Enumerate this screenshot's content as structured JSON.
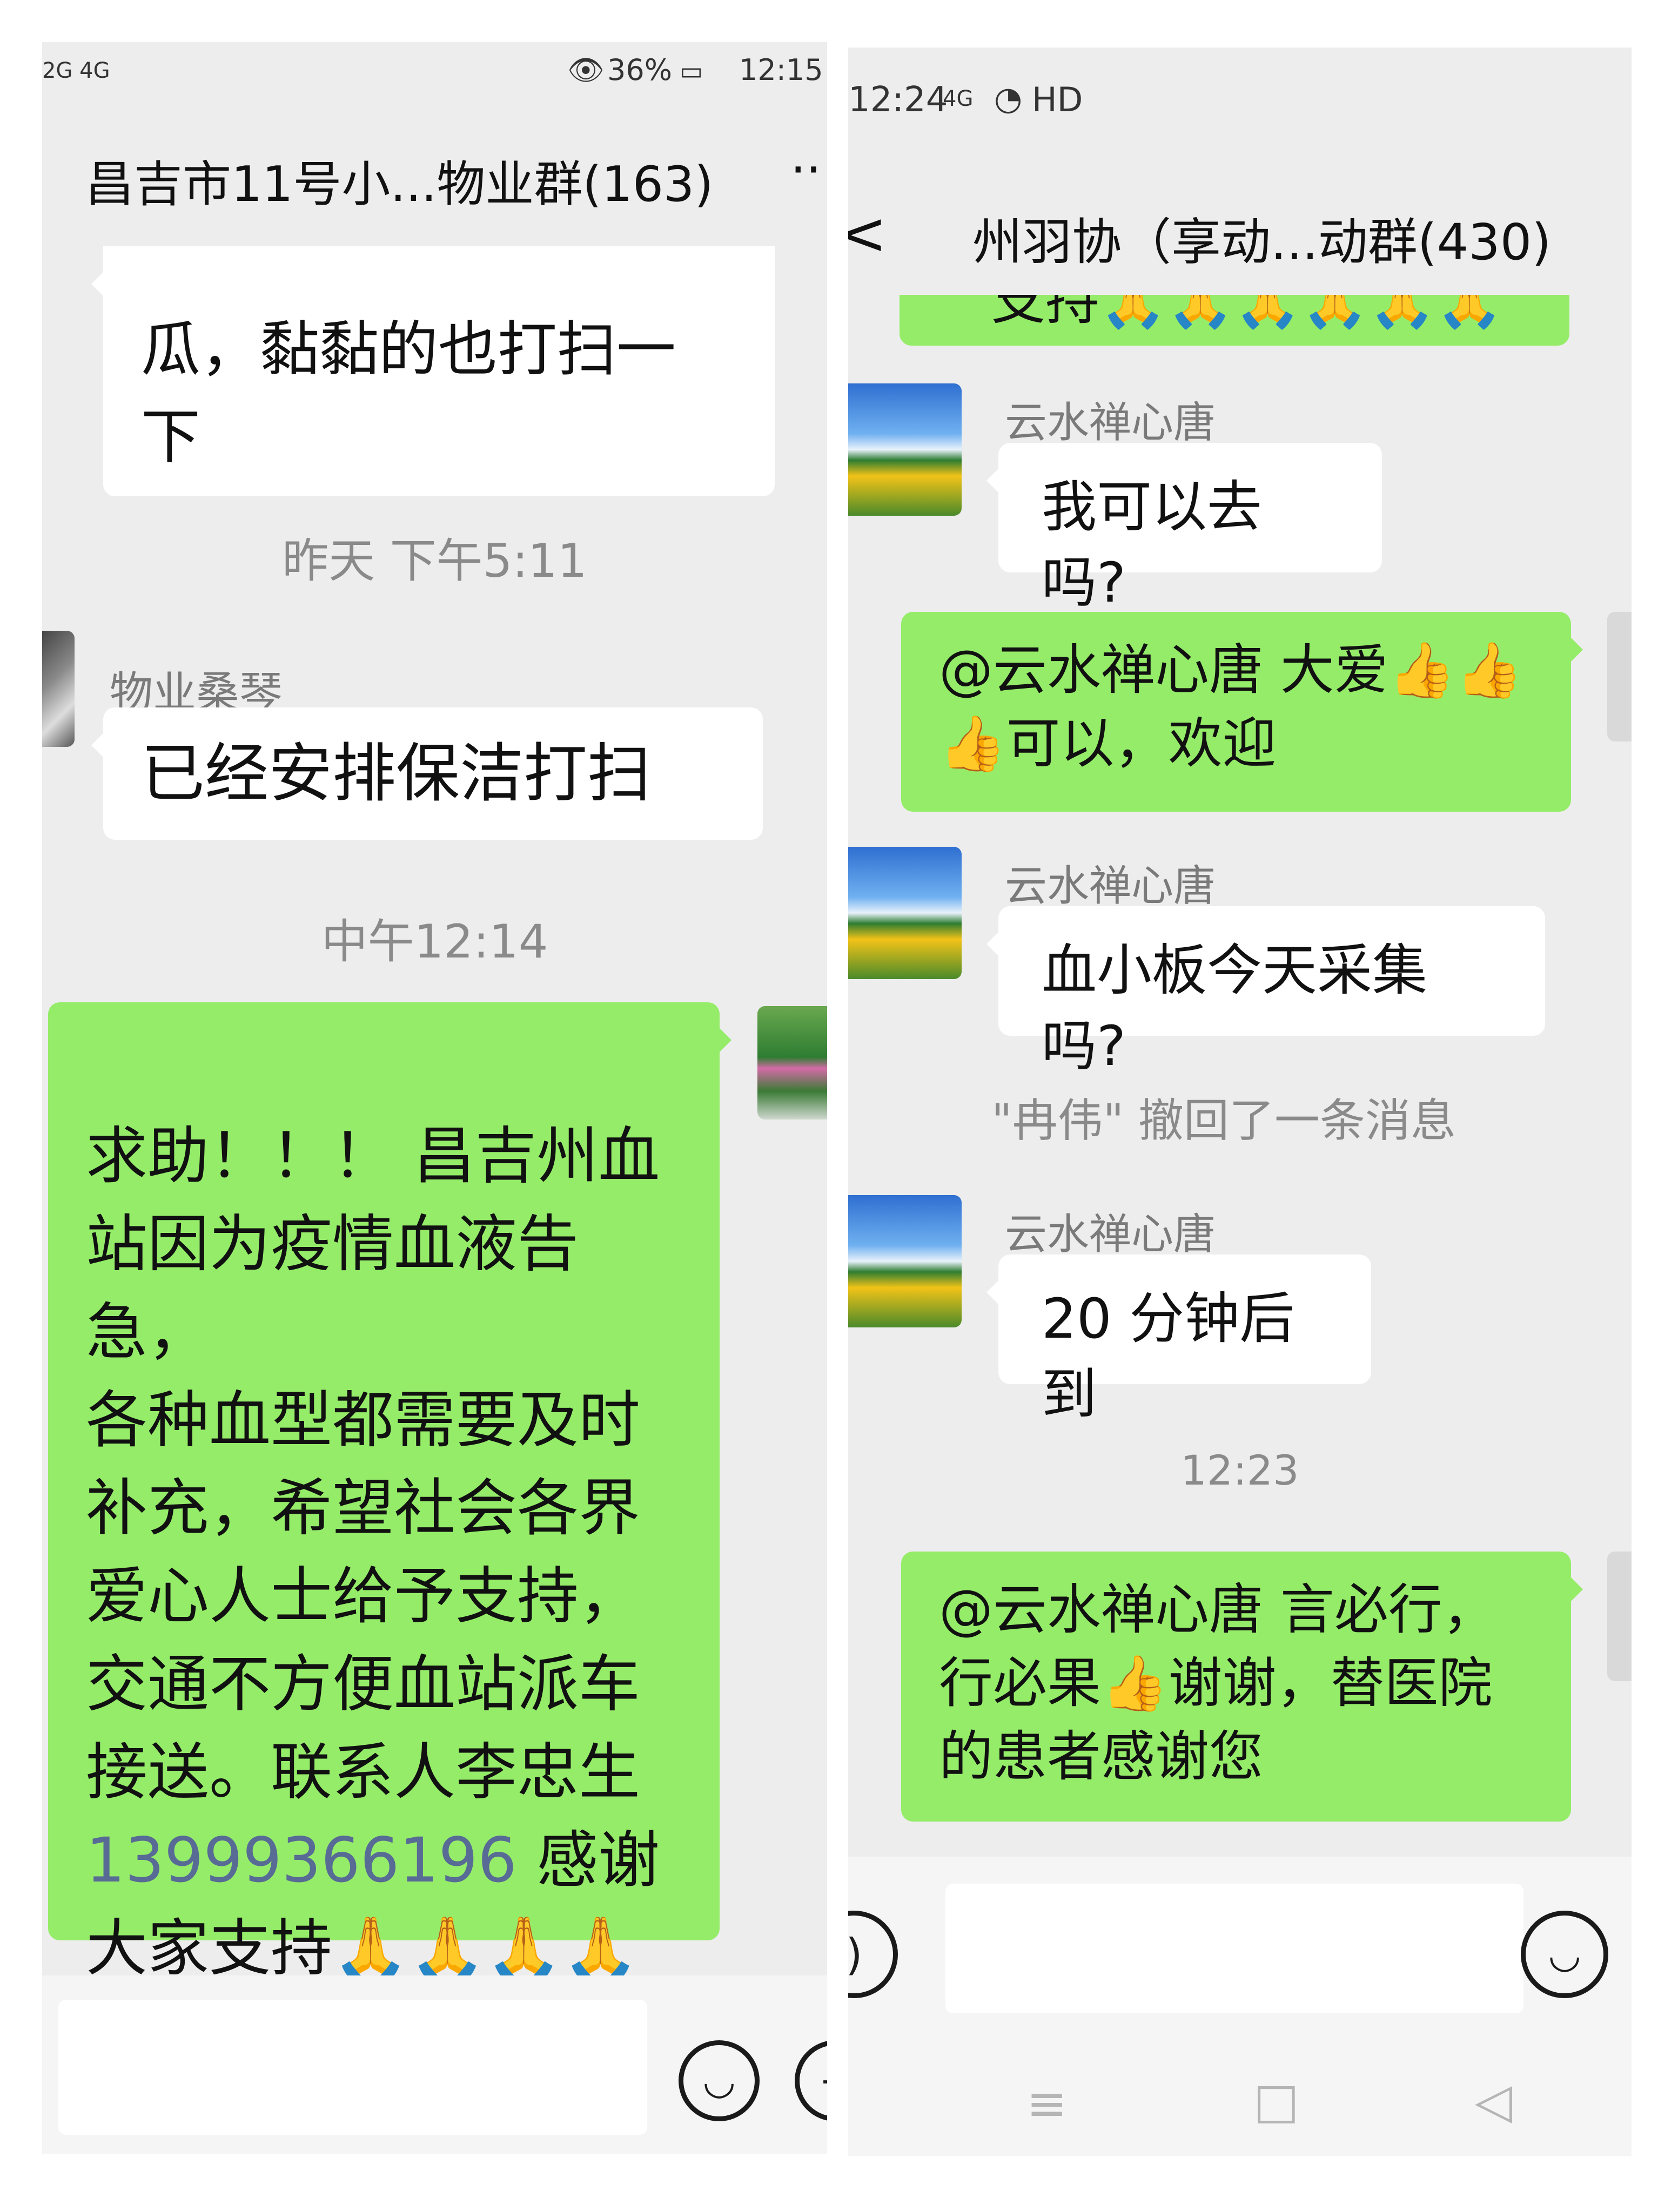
{
  "left_screen": {
    "status": {
      "signal": "2G 4G",
      "battery": "36%",
      "time": "12:15"
    },
    "chat_title": "昌吉市11号小...物业群(163)",
    "more_label": "··",
    "messages": {
      "partial_text": "瓜，黏黏的也打扫一\n下",
      "time1": "昨天 下午5:11",
      "sender1": "物业桑琴",
      "msg1": "已经安排保洁打扫",
      "time2": "中午12:14",
      "help_text_a": "求助！！！ 昌吉州血\n站因为疫情血液告急，\n各种血型都需要及时\n补充，希望社会各界\n爱心人士给予支持，\n交通不方便血站派车\n接送。联系人李忠生\n",
      "help_phone": "13999366196",
      "help_text_b": " 感谢\n大家支持🙏🙏🙏🙏\n🙏🙏"
    },
    "emoji_icon": "smiley-icon"
  },
  "right_screen": {
    "status": {
      "time": "12:24",
      "network": "4G",
      "hd": "HD"
    },
    "chat_title": "州羽协（享动...动群(430)",
    "back_label": "<",
    "messages": {
      "partial_text": "支持🙏🙏🙏🙏🙏🙏",
      "sender_a": "云水禅心唐",
      "msg_a": "我可以去吗?",
      "reply_a": "@云水禅心唐  大爱👍👍\n👍可以，欢迎",
      "sender_b": "云水禅心唐",
      "msg_b": "血小板今天采集吗?",
      "recall_notice": "\"冉伟\" 撤回了一条消息",
      "sender_c": "云水禅心唐",
      "msg_c": "20 分钟后到",
      "time_c": "12:23",
      "reply_c": "@云水禅心唐  言必行，\n行必果👍谢谢，替医院\n的患者感谢您"
    },
    "voice_icon": "voice-icon",
    "emoji_icon": "smiley-icon",
    "nav": [
      "menu-icon",
      "home-icon",
      "back-icon"
    ]
  }
}
